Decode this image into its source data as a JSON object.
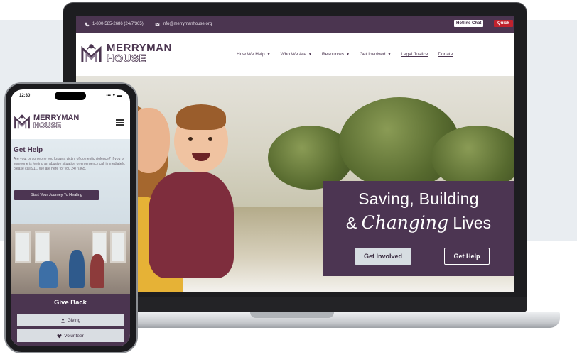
{
  "colors": {
    "brand_purple": "#4b3550",
    "hotline_bg": "#ffffff",
    "quick_exit_red": "#c0222d",
    "button_light": "#d7dde2"
  },
  "desktop": {
    "topbar": {
      "phone_icon": "phone-icon",
      "phone_text": "1-800-585-2686 (24/7/365)",
      "email_icon": "envelope-icon",
      "email_text": "info@merrymanhouse.org",
      "hotline_label": "Hotline Chat",
      "quick_exit_label": "Quick"
    },
    "logo": {
      "word1": "MERRYMAN",
      "word2": "HOUSE"
    },
    "nav": [
      {
        "label": "How We Help",
        "dropdown": true
      },
      {
        "label": "Who We Are",
        "dropdown": true
      },
      {
        "label": "Resources",
        "dropdown": true
      },
      {
        "label": "Get Involved",
        "dropdown": true
      },
      {
        "label": "Legal Justice",
        "dropdown": false
      },
      {
        "label": "Donate",
        "dropdown": false
      }
    ],
    "hero": {
      "line1": "Saving, Building",
      "amp": "&",
      "script_word": "Changing",
      "line2_end": "Lives",
      "btn_primary": "Get Involved",
      "btn_secondary": "Get Help"
    }
  },
  "mobile": {
    "status": {
      "time": "12:30",
      "signal": "▪▪▪ ▼ ▬"
    },
    "logo": {
      "word1": "MERRYMAN",
      "word2": "HOUSE"
    },
    "menu_icon": "hamburger-menu-icon",
    "help": {
      "title": "Get Help",
      "body": "Are you, or someone you know a victim of domestic violence? If you or someone is feeling an abusive situation or emergency call immediately, please call 911. We are here for you 24/7/365.",
      "button": "Start Your Journey To Healing"
    },
    "give_back": {
      "title": "Give Back",
      "giving_icon": "person-icon",
      "giving_label": "Giving",
      "volunteer_icon": "heart-icon",
      "volunteer_label": "Volunteer"
    }
  }
}
